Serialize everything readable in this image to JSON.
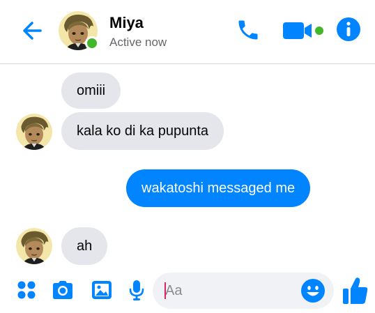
{
  "header": {
    "contact_name": "Miya",
    "status": "Active now"
  },
  "messages": [
    {
      "direction": "in",
      "text": "omiii"
    },
    {
      "direction": "in",
      "text": "kala ko di ka pupunta"
    },
    {
      "direction": "out",
      "text": "wakatoshi messaged me"
    },
    {
      "direction": "in",
      "text": "ah"
    }
  ],
  "composer": {
    "placeholder": "Aa",
    "value": ""
  },
  "colors": {
    "accent": "#0084ff",
    "online": "#42b72a",
    "incoming_bubble": "#e4e6eb"
  },
  "icons": {
    "back": "arrow-left-icon",
    "call": "phone-icon",
    "video": "video-camera-icon",
    "info": "info-icon",
    "menu": "four-dots-icon",
    "camera": "camera-icon",
    "gallery": "image-icon",
    "mic": "microphone-icon",
    "emoji": "smiley-icon",
    "like": "thumbs-up-icon"
  }
}
